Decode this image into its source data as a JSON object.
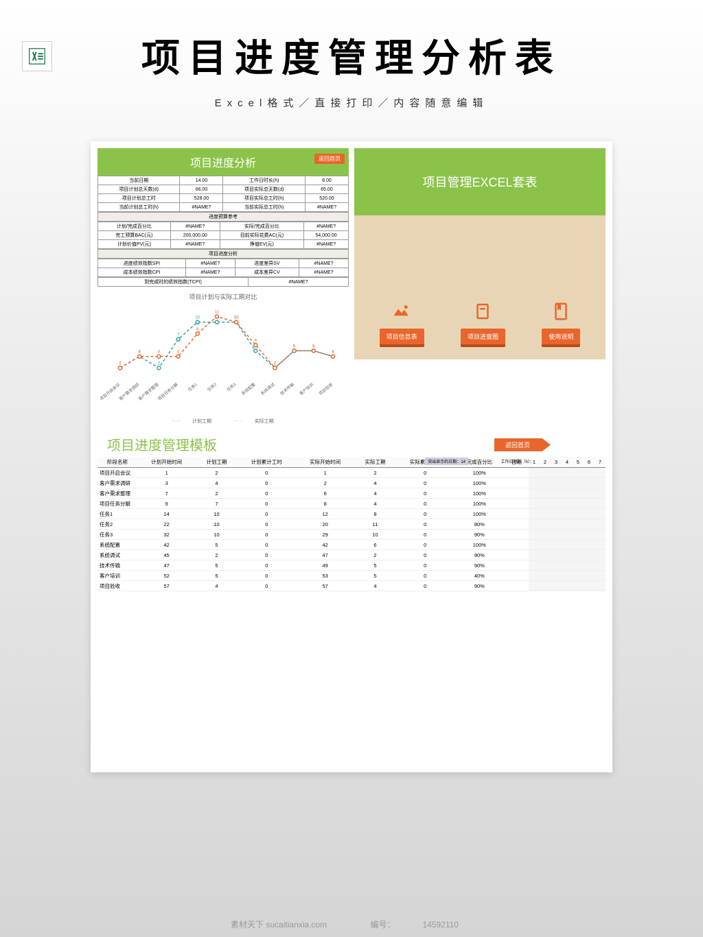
{
  "header": {
    "title": "项目进度管理分析表",
    "subtitle": "Excel格式／直接打印／内容随意编辑"
  },
  "left_panel": {
    "title": "项目进度分析",
    "back": "返回首页",
    "rows1": [
      [
        "当前日期",
        "14.00",
        "工作日时长(h)",
        "8.00"
      ],
      [
        "项目计划总天数(d)",
        "66.00",
        "项目实际总天数(d)",
        "65.00"
      ],
      [
        "项目计划总工时",
        "528.00",
        "项目实际总工时(h)",
        "520.00"
      ],
      [
        "当前计划总工时(h)",
        "#NAME?",
        "当前实际总工时(h)",
        "#NAME?"
      ]
    ],
    "sec2": "进度预算参考",
    "rows2": [
      [
        "计划/完成百分比",
        "#NAME?",
        "实际/完成百分比",
        "#NAME?"
      ],
      [
        "完工预算BAC(元)",
        "200,000.00",
        "目前实际花费AC(元)",
        "54,000.00"
      ],
      [
        "计划价值PV(元)",
        "#NAME?",
        "挣值EV(元)",
        "#NAME?"
      ]
    ],
    "sec3": "项目进度分析",
    "rows3": [
      [
        "进度绩效指数SPI",
        "#NAME?",
        "进度差异SV",
        "#NAME?"
      ],
      [
        "成本绩效指数CPI",
        "#NAME?",
        "成本差异CV",
        "#NAME?"
      ]
    ],
    "row4": [
      "到完成时的绩效指数(TCPI)",
      "#NAME?"
    ]
  },
  "chart_data": {
    "type": "line",
    "title": "项目计划与实际工期对比",
    "categories": [
      "项目开启会议",
      "客户需求调研",
      "客户需求整理",
      "项目任务分解",
      "任务1",
      "任务2",
      "任务3",
      "系统配置",
      "系统调试",
      "技术传输",
      "客户培训",
      "项目验收"
    ],
    "series": [
      {
        "name": "计划工期",
        "values": [
          2,
          4,
          2,
          7,
          10,
          10,
          10,
          5,
          2,
          5,
          5,
          4
        ],
        "color": "#2aa5a0"
      },
      {
        "name": "实际工期",
        "values": [
          2,
          4,
          4,
          4,
          8,
          11,
          10,
          6,
          2,
          5,
          5,
          4
        ],
        "color": "#e8662c"
      }
    ],
    "ylim": [
      0,
      12
    ]
  },
  "right_panel": {
    "title": "项目管理EXCEL套表",
    "nav": [
      {
        "label": "项目信息表"
      },
      {
        "label": "项目进度图"
      },
      {
        "label": "使用说明"
      }
    ]
  },
  "gantt": {
    "title": "项目进度管理模板",
    "back": "返回首页",
    "meta": {
      "date_label": "突出显示的日期：",
      "date_val": "14",
      "hours_label": "工作日时长（h）："
    },
    "headers": [
      "阶段名称",
      "计划开始时间",
      "计划工期",
      "计划累计工时",
      "实际开始时间",
      "实际工期",
      "实际累计工时",
      "完成百分比",
      "日期"
    ],
    "days": [
      "1",
      "2",
      "3",
      "4",
      "5",
      "6",
      "7"
    ],
    "rows": [
      {
        "name": "项目开启会议",
        "v": [
          "1",
          "2",
          "0",
          "1",
          "2",
          "0",
          "100%"
        ]
      },
      {
        "name": "客户需求调研",
        "v": [
          "3",
          "4",
          "0",
          "2",
          "4",
          "0",
          "100%"
        ]
      },
      {
        "name": "客户需求整理",
        "v": [
          "7",
          "2",
          "0",
          "6",
          "4",
          "0",
          "100%"
        ]
      },
      {
        "name": "项目任务分解",
        "v": [
          "9",
          "7",
          "0",
          "8",
          "4",
          "0",
          "100%"
        ]
      },
      {
        "name": "任务1",
        "v": [
          "14",
          "10",
          "0",
          "12",
          "8",
          "0",
          "100%"
        ]
      },
      {
        "name": "任务2",
        "v": [
          "22",
          "10",
          "0",
          "20",
          "11",
          "0",
          "80%"
        ]
      },
      {
        "name": "任务3",
        "v": [
          "32",
          "10",
          "0",
          "29",
          "10",
          "0",
          "90%"
        ]
      },
      {
        "name": "系统配置",
        "v": [
          "42",
          "5",
          "0",
          "42",
          "6",
          "0",
          "100%"
        ]
      },
      {
        "name": "系统调试",
        "v": [
          "45",
          "2",
          "0",
          "47",
          "2",
          "0",
          "90%"
        ]
      },
      {
        "name": "技术传输",
        "v": [
          "47",
          "5",
          "0",
          "49",
          "5",
          "0",
          "90%"
        ]
      },
      {
        "name": "客户培训",
        "v": [
          "52",
          "5",
          "0",
          "53",
          "5",
          "0",
          "40%"
        ]
      },
      {
        "name": "项目验收",
        "v": [
          "57",
          "4",
          "0",
          "57",
          "4",
          "0",
          "90%"
        ]
      }
    ]
  },
  "footer": {
    "site": "素材天下 sucaitianxia.com",
    "id_label": "编号：",
    "id": "14592110"
  }
}
